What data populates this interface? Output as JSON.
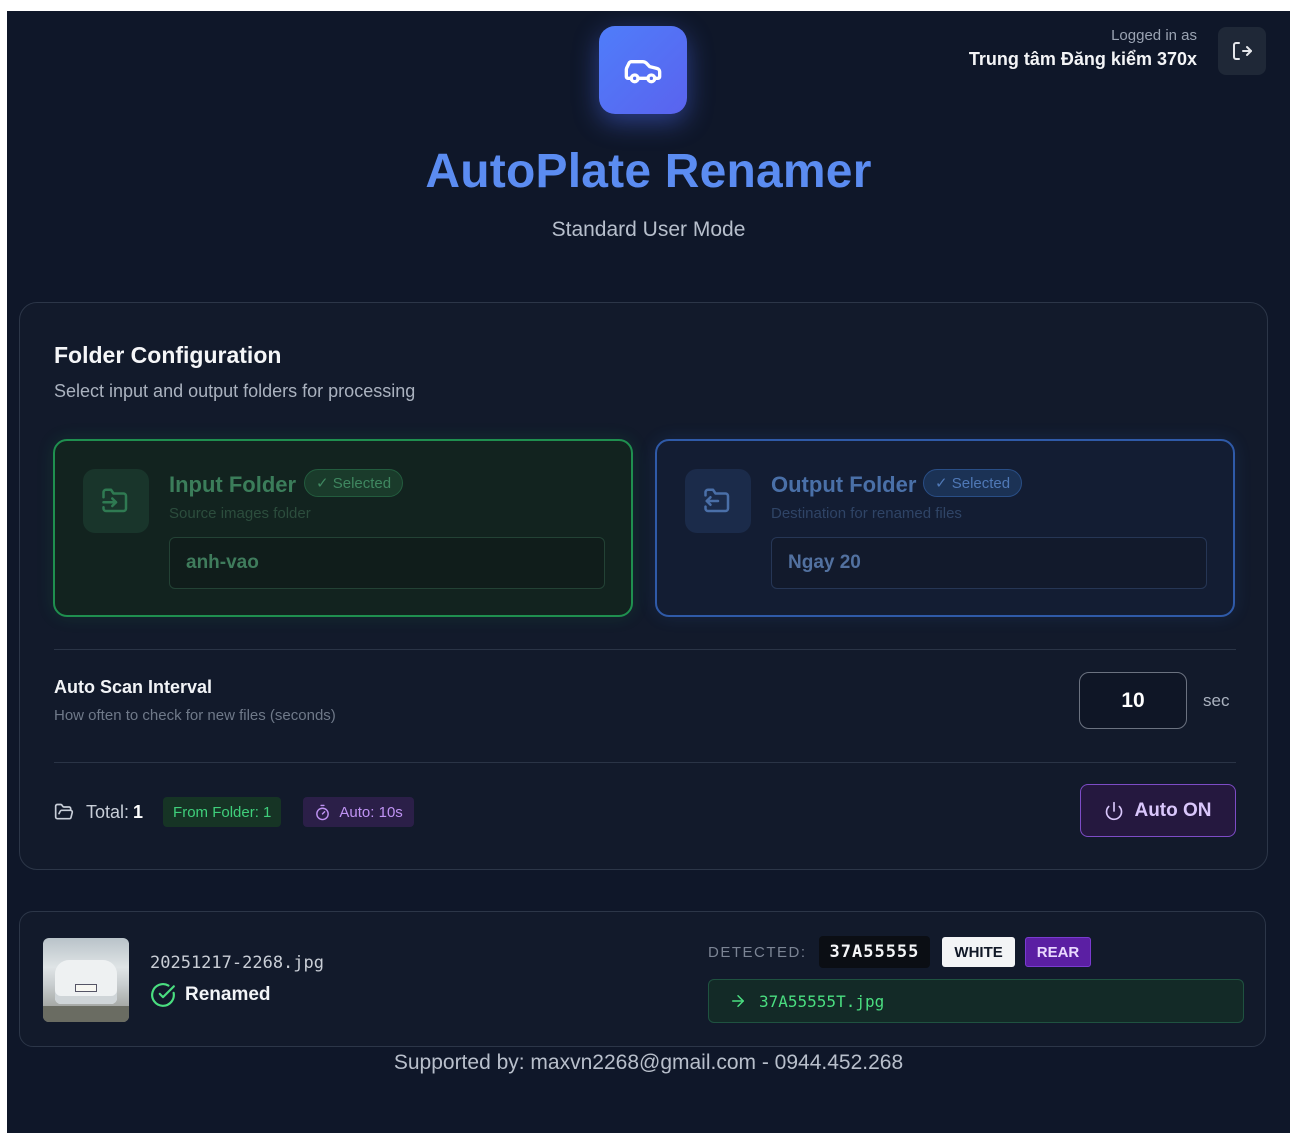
{
  "header": {
    "title": "AutoPlate Renamer",
    "subtitle": "Standard User Mode",
    "logo_icon": "car-icon",
    "logged_in_label": "Logged in as",
    "user_name": "Trung tâm Đăng kiểm 370x",
    "logout_icon": "logout-icon"
  },
  "folder_config": {
    "title": "Folder Configuration",
    "description": "Select input and output folders for processing",
    "input": {
      "label": "Input Folder",
      "status": "✓ Selected",
      "hint": "Source images folder",
      "value": "anh-vao",
      "icon": "folder-input-icon"
    },
    "output": {
      "label": "Output Folder",
      "status": "✓ Selected",
      "hint": "Destination for renamed files",
      "value": "Ngay 20",
      "icon": "folder-output-icon"
    }
  },
  "auto_scan": {
    "title": "Auto Scan Interval",
    "description": "How often to check for new files (seconds)",
    "value": "10",
    "unit": "sec"
  },
  "stats": {
    "total_label": "Total:",
    "total_value": "1",
    "from_folder": "From Folder: 1",
    "auto_badge": "Auto: 10s",
    "auto_button": "Auto ON"
  },
  "results": [
    {
      "file_name": "20251217-2268.jpg",
      "status": "Renamed",
      "detected_label": "DETECTED:",
      "plate": "37A55555",
      "plate_color": "WHITE",
      "position": "REAR",
      "new_name": "37A55555T.jpg"
    }
  ],
  "footer": {
    "text": "Supported by: maxvn2268@gmail.com - 0944.452.268"
  },
  "colors": {
    "background": "#0f1729",
    "title_blue": "#5b8cf1",
    "logo_gradient_start": "#4f7dfa",
    "success_green": "#4ade80",
    "accent_purple": "#7d4cc6"
  }
}
